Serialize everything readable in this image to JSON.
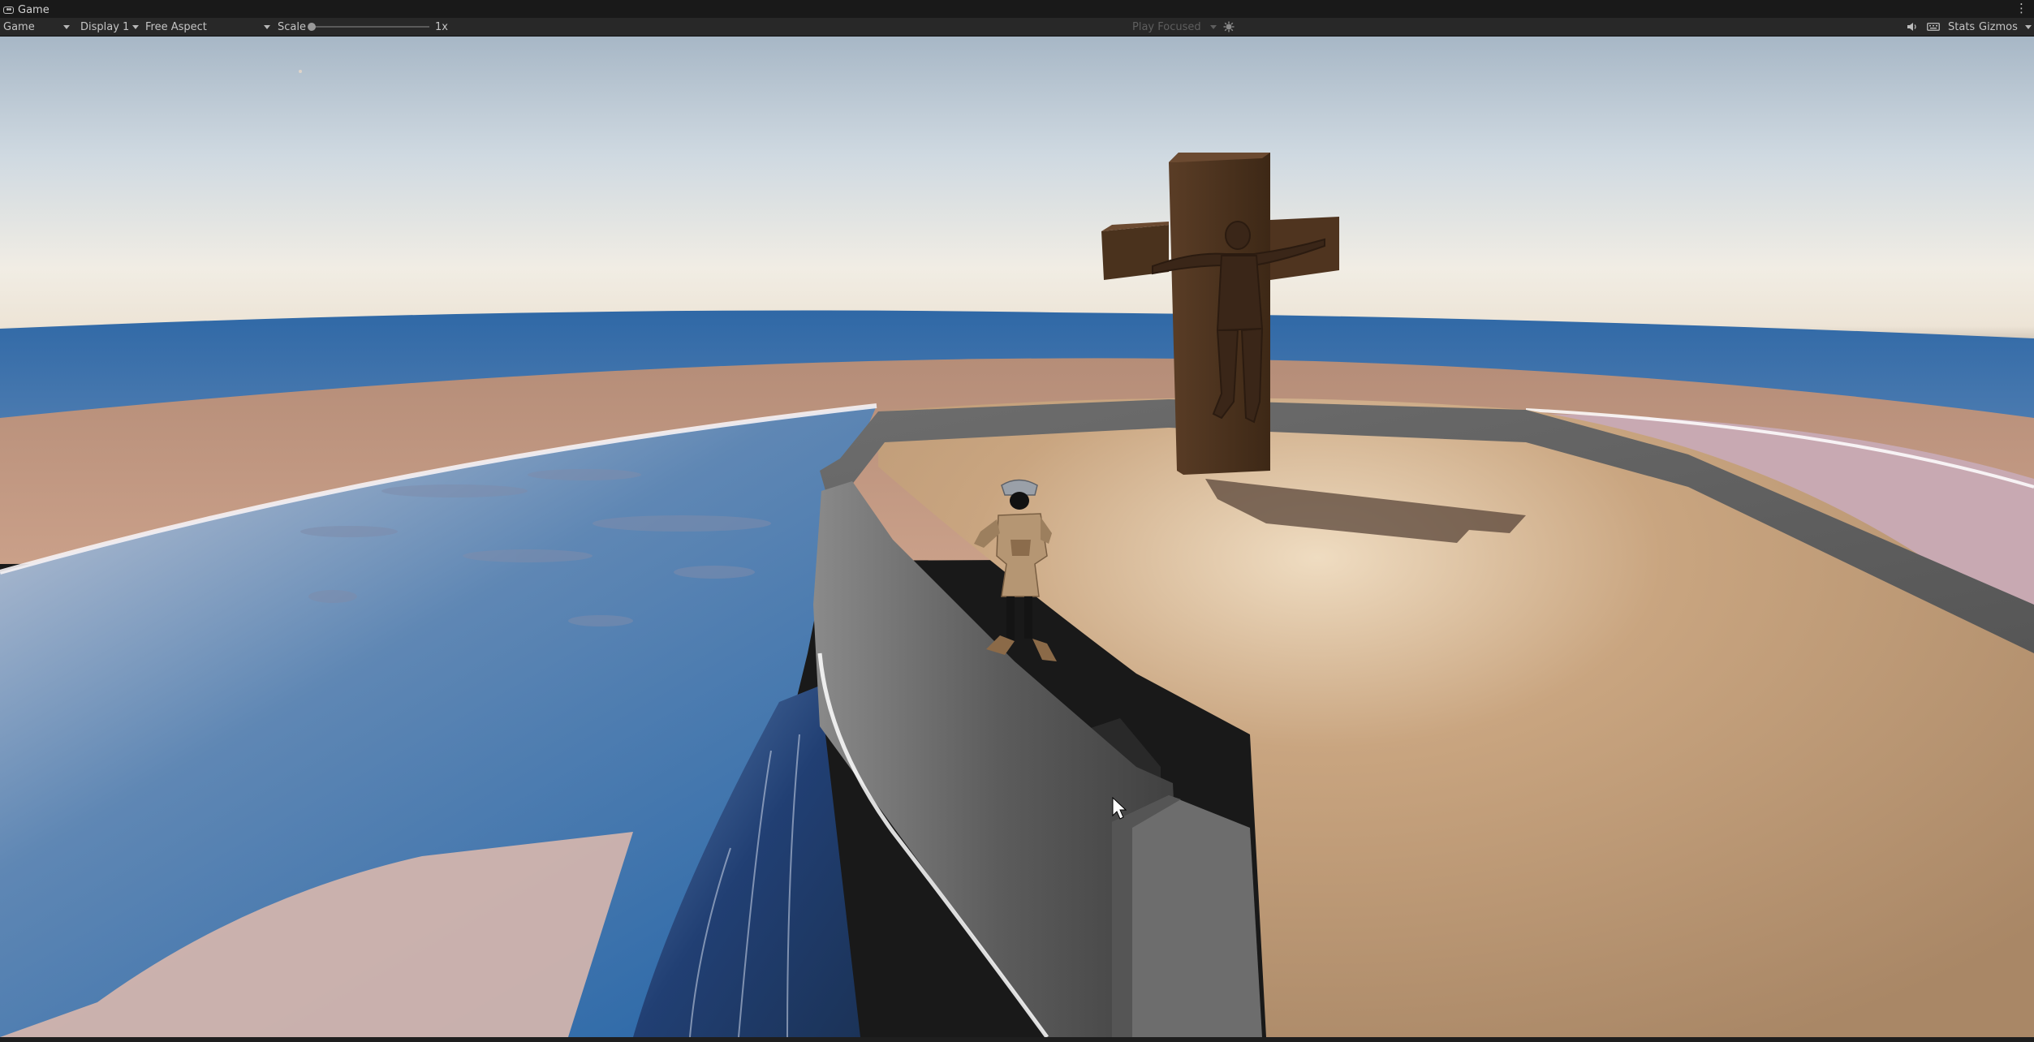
{
  "window": {
    "tab_title": "Game",
    "tab_icon": "gamepad-icon",
    "menu": "⋮"
  },
  "toolbar": {
    "view_mode": "Game",
    "display": "Display 1",
    "aspect": "Free Aspect",
    "scale_label": "Scale",
    "scale_value": "1x",
    "scale_level": 0,
    "play_mode": "Play Focused",
    "stats_label": "Stats",
    "gizmos_label": "Gizmos"
  },
  "colors": {
    "panel_bg": "#191919",
    "toolbar_bg": "#282828",
    "sky_top": "#9bb0c4",
    "horizon": "#f3ede2",
    "sea": "#3d6ea6",
    "sand": "#b9976f",
    "wall": "#5f5f5f",
    "cross": "#4a3120"
  }
}
